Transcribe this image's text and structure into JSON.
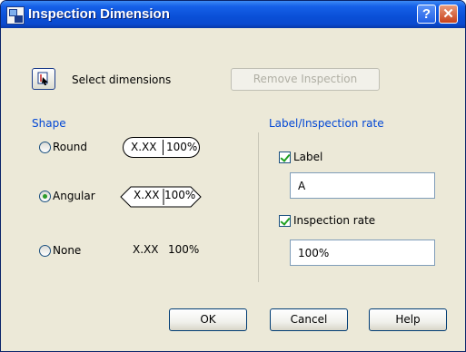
{
  "window": {
    "title": "Inspection Dimension"
  },
  "titlebar": {
    "help_glyph": "?",
    "close_glyph": "✕"
  },
  "top": {
    "select_label": "Select dimensions",
    "remove_label": "Remove Inspection"
  },
  "shape": {
    "group_label": "Shape",
    "options": [
      {
        "label": "Round",
        "selected": false
      },
      {
        "label": "Angular",
        "selected": true
      },
      {
        "label": "None",
        "selected": false
      }
    ],
    "preview_value": "X.XX",
    "preview_rate": "100%"
  },
  "label_group": {
    "group_label": "Label/Inspection rate",
    "label_checkbox": "Label",
    "label_checked": true,
    "label_value": "A",
    "rate_checkbox": "Inspection rate",
    "rate_checked": true,
    "rate_value": "100%"
  },
  "buttons": {
    "ok": "OK",
    "cancel": "Cancel",
    "help": "Help"
  },
  "colors": {
    "title_bar": "#0a4fd6",
    "group_label": "#0046d5",
    "dialog_bg": "#ece9d8"
  }
}
